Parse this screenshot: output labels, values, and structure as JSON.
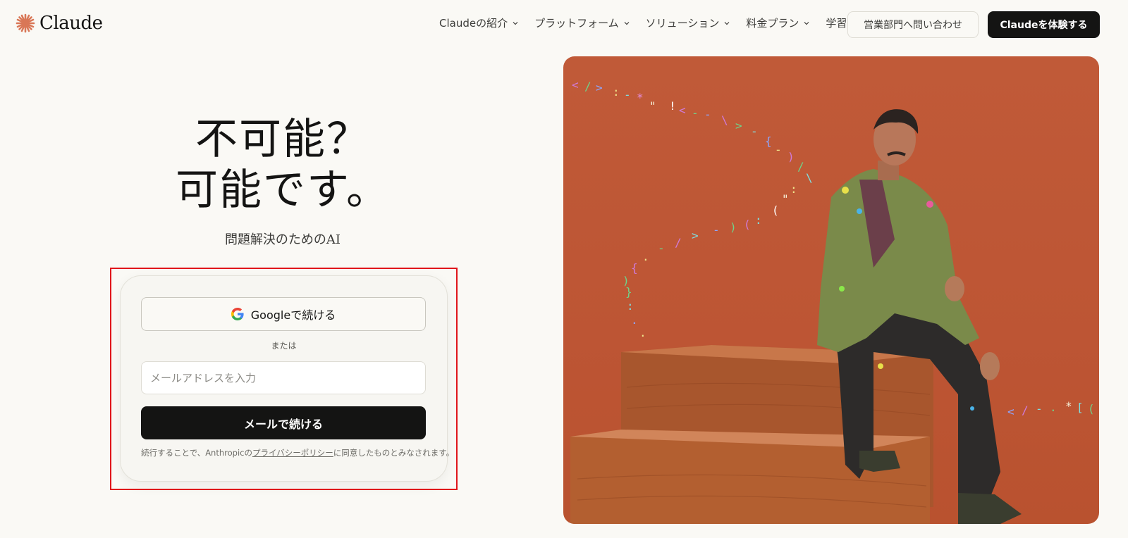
{
  "brand": {
    "name": "Claude",
    "logo_color": "#d97757"
  },
  "nav": {
    "items": [
      {
        "label": "Claudeの紹介",
        "name": "nav-about"
      },
      {
        "label": "プラットフォーム",
        "name": "nav-platform"
      },
      {
        "label": "ソリューション",
        "name": "nav-solutions"
      },
      {
        "label": "料金プラン",
        "name": "nav-pricing"
      },
      {
        "label": "学習",
        "name": "nav-learn"
      }
    ],
    "sales_label": "営業部門へ問い合わせ",
    "try_label": "Claudeを体験する"
  },
  "hero": {
    "title_line1": "不可能？",
    "title_line2": "可能です。",
    "subtitle": "問題解決のためのAI"
  },
  "signin": {
    "google_label": "Googleで続ける",
    "or_label": "または",
    "email_placeholder": "メールアドレスを入力",
    "email_button": "メールで続ける",
    "legal_prefix": "続行することで、Anthropicの",
    "legal_link": "プライバシーポリシー",
    "legal_suffix": "に同意したものとみなされます。"
  },
  "colors": {
    "background": "#faf9f5",
    "primary_button": "#141413",
    "highlight": "#e0161b",
    "photo_background": "#c05a38"
  }
}
